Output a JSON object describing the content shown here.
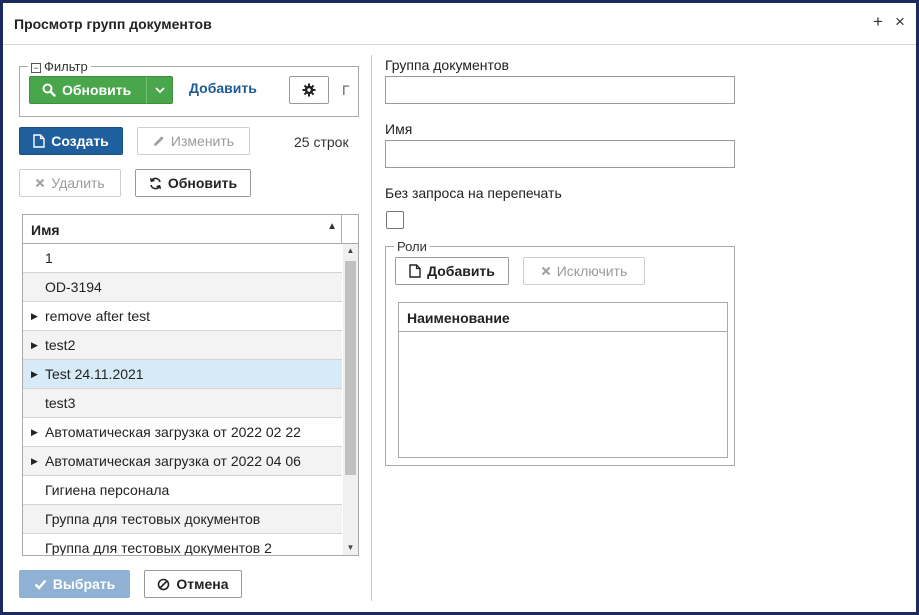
{
  "window": {
    "title": "Просмотр групп документов",
    "pin_glyph": "+",
    "close_glyph": "×"
  },
  "filter": {
    "legend": "Фильтр",
    "refresh_label": "Обновить",
    "add_label": "Добавить",
    "truncated_text": "Г"
  },
  "toolbar": {
    "create_label": "Создать",
    "edit_label": "Изменить",
    "row_count": "25 строк",
    "delete_label": "Удалить",
    "refresh_label": "Обновить"
  },
  "grid": {
    "column_header": "Имя",
    "rows": [
      {
        "label": "1",
        "expandable": false
      },
      {
        "label": "OD-3194",
        "expandable": false
      },
      {
        "label": "remove after test",
        "expandable": true
      },
      {
        "label": "test2",
        "expandable": true
      },
      {
        "label": "Test 24.11.2021",
        "expandable": true,
        "selected": true
      },
      {
        "label": "test3",
        "expandable": false
      },
      {
        "label": "Автоматическая загрузка от 2022 02 22",
        "expandable": true
      },
      {
        "label": "Автоматическая загрузка от 2022 04 06",
        "expandable": true
      },
      {
        "label": "Гигиена персонала",
        "expandable": false
      },
      {
        "label": "Группа для тестовых документов",
        "expandable": false
      },
      {
        "label": "Группа для тестовых документов 2",
        "expandable": false
      }
    ]
  },
  "footer": {
    "select_label": "Выбрать",
    "cancel_label": "Отмена"
  },
  "form": {
    "group_label": "Группа документов",
    "group_value": "",
    "name_label": "Имя",
    "name_value": "",
    "no_reprint_label": "Без запроса на перепечать",
    "no_reprint_checked": false
  },
  "roles": {
    "legend": "Роли",
    "add_label": "Добавить",
    "exclude_label": "Исключить",
    "column_header": "Наименование",
    "rows": []
  },
  "colors": {
    "primary": "#1f5f9e",
    "green": "#4aa64a",
    "selected_row": "#d7eaf7",
    "border_frame": "#1a2a5e"
  }
}
